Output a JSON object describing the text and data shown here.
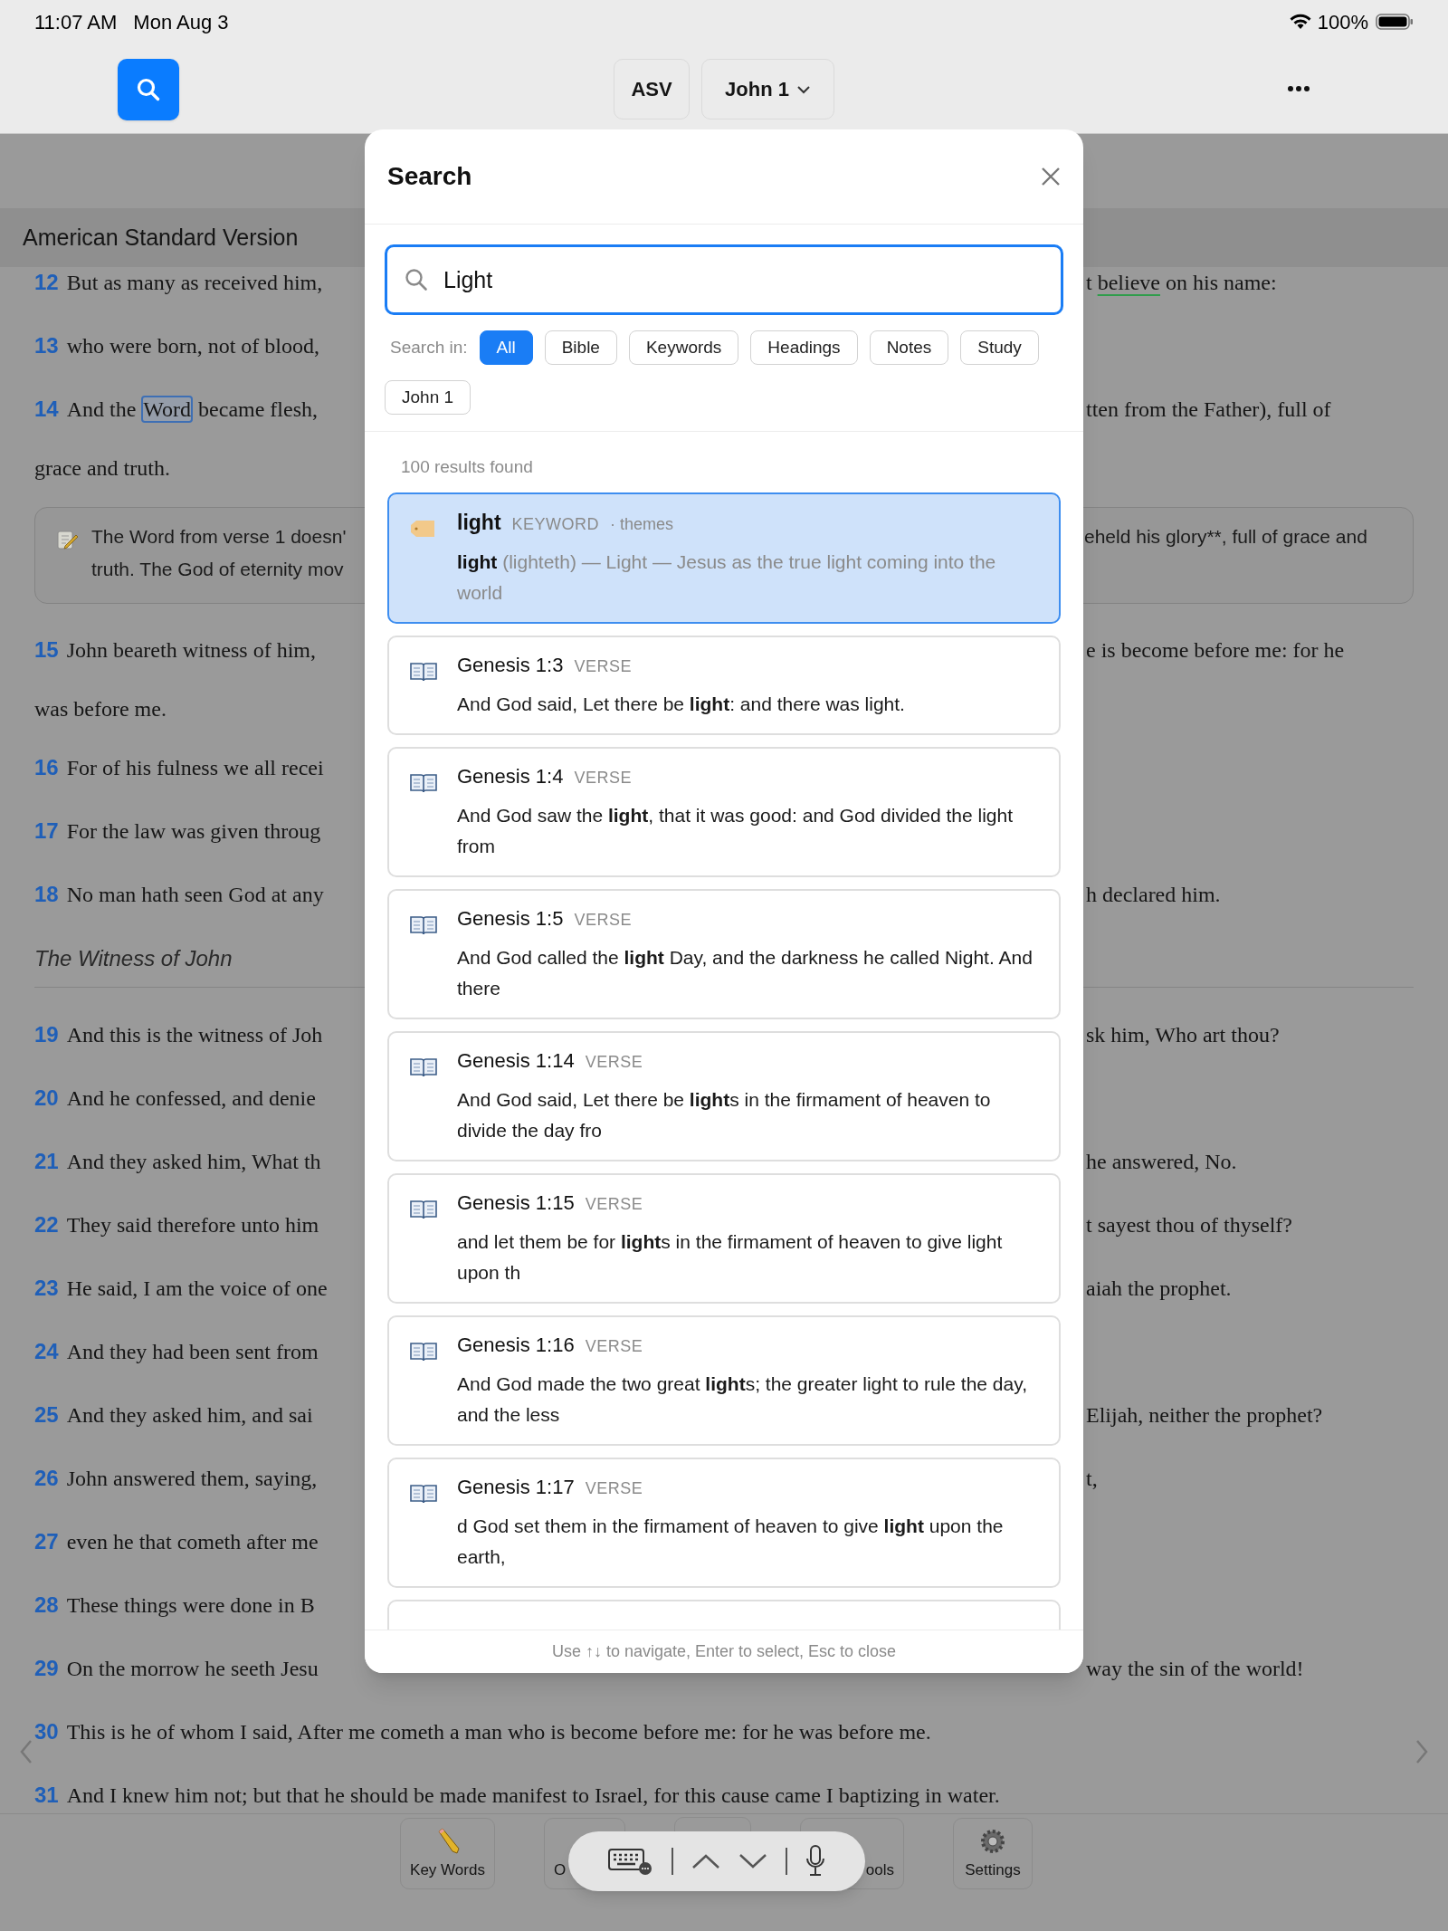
{
  "status_bar": {
    "time": "11:07 AM",
    "date": "Mon Aug 3",
    "battery": "100%"
  },
  "toolbar": {
    "translation": "ASV",
    "chapter": "John 1"
  },
  "version_header": "American Standard Version",
  "passage": [
    {
      "kind": "verse",
      "number": "12",
      "left": [
        {
          "text": "But as many as received him,",
          "kind": "plain"
        }
      ],
      "right": [
        {
          "text": "t",
          "kind": "plain"
        },
        {
          "text": "believe",
          "kind": "underlined"
        },
        {
          "text": "on his name:",
          "kind": "plain"
        }
      ]
    },
    {
      "kind": "verse",
      "number": "13",
      "left": [
        {
          "text": "who were born, not of blood,",
          "kind": "plain"
        }
      ]
    },
    {
      "kind": "verse",
      "number": "14",
      "left": [
        {
          "text": "And the",
          "kind": "plain"
        },
        {
          "text": "Word",
          "kind": "marked"
        },
        {
          "text": "became flesh,",
          "kind": "plain"
        }
      ],
      "right": [
        {
          "text": "tten from the Father), full of",
          "kind": "plain"
        }
      ],
      "continuation": "grace and truth."
    },
    {
      "kind": "note",
      "lines_left": [
        "The Word from verse 1 doesn'",
        "truth. The God of eternity mov"
      ],
      "lines_right": [
        "eheld his glory**, full of grace and"
      ]
    },
    {
      "kind": "verse",
      "number": "15",
      "left": [
        {
          "text": "John beareth witness of him,",
          "kind": "plain"
        }
      ],
      "right": [
        {
          "text": "e is become before me: for he",
          "kind": "plain"
        }
      ],
      "continuation": "was before me."
    },
    {
      "kind": "verse",
      "number": "16",
      "left": [
        {
          "text": "For of his fulness we all recei",
          "kind": "plain"
        }
      ]
    },
    {
      "kind": "verse",
      "number": "17",
      "left": [
        {
          "text": "For the law was given throug",
          "kind": "plain"
        }
      ]
    },
    {
      "kind": "verse",
      "number": "18",
      "left": [
        {
          "text": "No man hath seen God at any",
          "kind": "plain"
        }
      ],
      "right": [
        {
          "text": "h declared him.",
          "kind": "plain"
        }
      ]
    },
    {
      "kind": "heading",
      "text": "The Witness of John"
    },
    {
      "kind": "verse",
      "number": "19",
      "left": [
        {
          "text": "And this is the witness of Joh",
          "kind": "plain"
        }
      ],
      "right": [
        {
          "text": "sk him, Who art thou?",
          "kind": "plain"
        }
      ]
    },
    {
      "kind": "verse",
      "number": "20",
      "left": [
        {
          "text": "And he confessed, and denie",
          "kind": "plain"
        }
      ]
    },
    {
      "kind": "verse",
      "number": "21",
      "left": [
        {
          "text": "And they asked him, What th",
          "kind": "plain"
        }
      ],
      "right": [
        {
          "text": "he answered, No.",
          "kind": "plain"
        }
      ]
    },
    {
      "kind": "verse",
      "number": "22",
      "left": [
        {
          "text": "They said therefore unto him",
          "kind": "plain"
        }
      ],
      "right": [
        {
          "text": "t sayest thou of thyself?",
          "kind": "plain"
        }
      ]
    },
    {
      "kind": "verse",
      "number": "23",
      "left": [
        {
          "text": "He said, I am the voice of one",
          "kind": "plain"
        }
      ],
      "right": [
        {
          "text": "aiah the prophet.",
          "kind": "plain"
        }
      ]
    },
    {
      "kind": "verse",
      "number": "24",
      "left": [
        {
          "text": "And they had been sent from",
          "kind": "plain"
        }
      ]
    },
    {
      "kind": "verse",
      "number": "25",
      "left": [
        {
          "text": "And they asked him, and sai",
          "kind": "plain"
        }
      ],
      "right": [
        {
          "text": "Elijah, neither the prophet?",
          "kind": "plain"
        }
      ]
    },
    {
      "kind": "verse",
      "number": "26",
      "left": [
        {
          "text": "John answered them, saying,",
          "kind": "plain"
        }
      ],
      "right": [
        {
          "text": "t,",
          "kind": "plain"
        }
      ]
    },
    {
      "kind": "verse",
      "number": "27",
      "left": [
        {
          "text": "even he that cometh after me",
          "kind": "plain"
        }
      ]
    },
    {
      "kind": "verse",
      "number": "28",
      "left": [
        {
          "text": "These things were done in B",
          "kind": "plain"
        }
      ]
    },
    {
      "kind": "verse",
      "number": "29",
      "left": [
        {
          "text": "On the morrow he seeth Jesu",
          "kind": "plain"
        }
      ],
      "right": [
        {
          "text": "way the sin of the world!",
          "kind": "plain"
        }
      ]
    },
    {
      "kind": "verse",
      "number": "30",
      "left": [
        {
          "text": "This is he of whom I said, After me cometh a man who is become before me: for he was before me.",
          "kind": "plain"
        }
      ]
    },
    {
      "kind": "verse",
      "number": "31",
      "left": [
        {
          "text": "And I knew him not; but that he should be made manifest to Israel, for this cause came I baptizing in water.",
          "kind": "plain"
        }
      ]
    }
  ],
  "bottom_toolbar": [
    {
      "label": "Key Words",
      "kind": "pencil"
    },
    {
      "label": "O",
      "kind": "none",
      "cut_at_end": true
    },
    {
      "label": "ools",
      "kind": "none",
      "cut_at_start": true
    },
    {
      "label": "Settings",
      "kind": "gear"
    }
  ],
  "search_dialog": {
    "title": "Search",
    "query": "Light",
    "scope_label": "Search in:",
    "scopes": [
      {
        "label": "All",
        "selected": true
      },
      {
        "label": "Bible",
        "selected": false
      },
      {
        "label": "Keywords",
        "selected": false
      },
      {
        "label": "Headings",
        "selected": false
      },
      {
        "label": "Notes",
        "selected": false
      },
      {
        "label": "Study",
        "selected": false
      },
      {
        "label": "John 1",
        "selected": false
      }
    ],
    "results_count": "100 results found",
    "results": [
      {
        "kind": "keyword",
        "title": "light",
        "type_label": "KEYWORD",
        "meta": "· themes",
        "match": "light",
        "snippet": "(lighteth) — Light — Jesus as the true light coming into the world",
        "selected": true
      },
      {
        "kind": "verse",
        "title": "Genesis 1:3",
        "type_label": "VERSE",
        "snippet": "And God said, Let there be **light**: and there was light.",
        "selected": false
      },
      {
        "kind": "verse",
        "title": "Genesis 1:4",
        "type_label": "VERSE",
        "snippet": "And God saw the **light**, that it was good: and God divided the light from",
        "selected": false
      },
      {
        "kind": "verse",
        "title": "Genesis 1:5",
        "type_label": "VERSE",
        "snippet": "And God called the **light** Day, and the darkness he called Night. And there",
        "selected": false
      },
      {
        "kind": "verse",
        "title": "Genesis 1:14",
        "type_label": "VERSE",
        "snippet": "And God said, Let there be **light**s in the firmament of heaven to divide the day fro",
        "selected": false
      },
      {
        "kind": "verse",
        "title": "Genesis 1:15",
        "type_label": "VERSE",
        "snippet": "and let them be for **light**s in the firmament of heaven to give light upon th",
        "selected": false
      },
      {
        "kind": "verse",
        "title": "Genesis 1:16",
        "type_label": "VERSE",
        "snippet": "And God made the two great **light**s; the greater light to rule the day, and the less",
        "selected": false
      },
      {
        "kind": "verse",
        "title": "Genesis 1:17",
        "type_label": "VERSE",
        "snippet": "d God set them in the firmament of heaven to give **light** upon the earth,",
        "selected": false
      }
    ],
    "footer_hint": "Use ↑↓ to navigate, Enter to select, Esc to close"
  }
}
